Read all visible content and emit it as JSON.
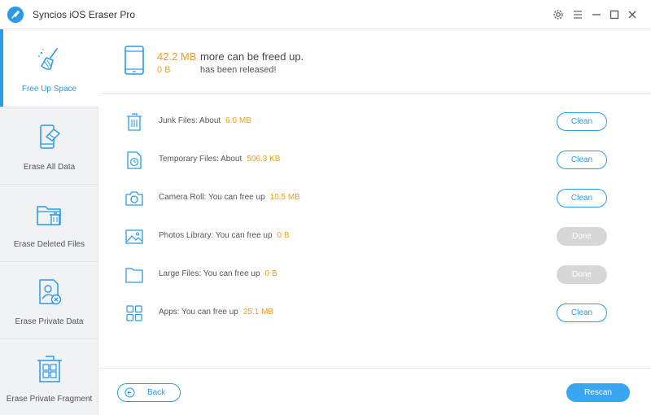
{
  "app": {
    "title": "Syncios iOS Eraser Pro",
    "accent_color": "#2a9ae6",
    "highlight_color": "#f39c12"
  },
  "titlebar": {
    "icons": [
      "settings-icon",
      "menu-icon",
      "minimize-icon",
      "maximize-icon",
      "close-icon"
    ]
  },
  "sidebar": {
    "items": [
      {
        "label": "Free Up Space",
        "icon": "broom-icon",
        "active": true
      },
      {
        "label": "Erase All Data",
        "icon": "erase-phone-icon",
        "active": false
      },
      {
        "label": "Erase Deleted Files",
        "icon": "folder-trash-icon",
        "active": false
      },
      {
        "label": "Erase Private Data",
        "icon": "private-user-icon",
        "active": false
      },
      {
        "label": "Erase Private Fragment",
        "icon": "fragment-trash-icon",
        "active": false
      }
    ]
  },
  "summary": {
    "freeable_size": "42.2 MB",
    "freeable_text": "more can be freed up.",
    "released_size": "0 B",
    "released_text": "has been released!"
  },
  "rows": [
    {
      "label": "Junk Files: About",
      "value": "6.0 MB",
      "button": "Clean",
      "state": "clean",
      "icon": "trash-icon"
    },
    {
      "label": "Temporary Files: About",
      "value": "506.3 KB",
      "button": "Clean",
      "state": "clean",
      "icon": "temp-file-icon"
    },
    {
      "label": "Camera Roll: You can free up",
      "value": "10.5 MB",
      "button": "Clean",
      "state": "clean",
      "icon": "camera-icon"
    },
    {
      "label": "Photos Library: You can free up",
      "value": "0 B",
      "button": "Done",
      "state": "done",
      "icon": "photo-icon"
    },
    {
      "label": "Large Files: You can free up",
      "value": "0 B",
      "button": "Done",
      "state": "done",
      "icon": "file-icon"
    },
    {
      "label": "Apps: You can free up",
      "value": "25.1 MB",
      "button": "Clean",
      "state": "clean",
      "icon": "apps-icon"
    }
  ],
  "footer": {
    "back_label": "Back",
    "rescan_label": "Rescan"
  }
}
